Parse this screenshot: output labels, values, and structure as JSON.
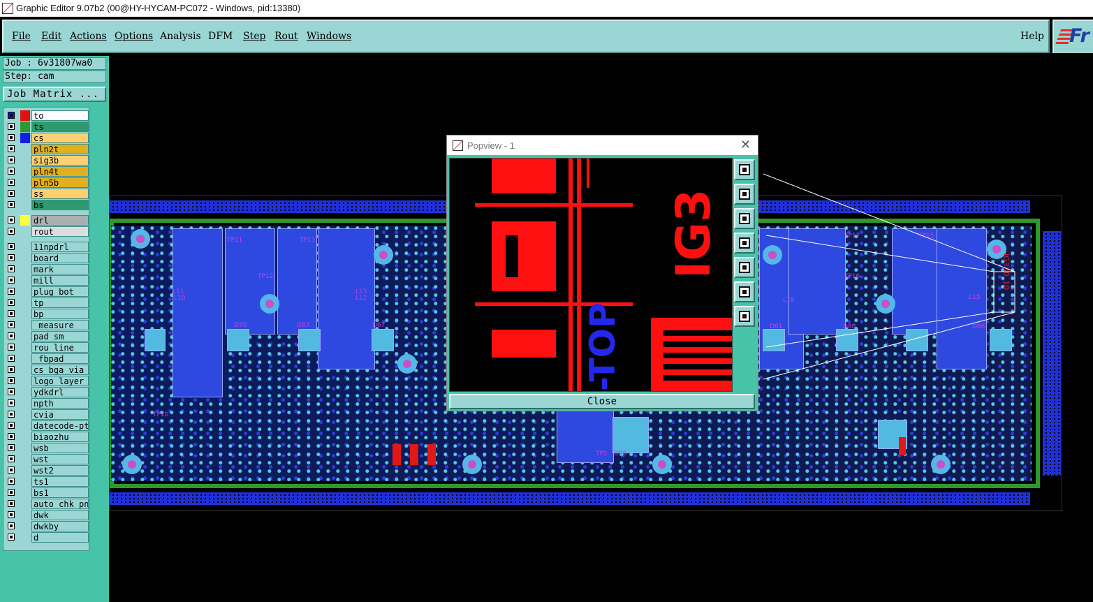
{
  "window": {
    "title": "Graphic Editor 9.07b2 (00@HY-HYCAM-PC072 - Windows, pid:13380)"
  },
  "menu": {
    "items": [
      {
        "label": "File"
      },
      {
        "label": "Edit"
      },
      {
        "label": "Actions"
      },
      {
        "label": "Options"
      },
      {
        "label": "Analysis"
      },
      {
        "label": "DFM"
      },
      {
        "label": "Step"
      },
      {
        "label": "Rout"
      },
      {
        "label": "Windows"
      }
    ],
    "help": "Help",
    "logo_text": "Fr"
  },
  "job": {
    "job_line": "Job : 6v31807wa0",
    "step_line": "Step: cam",
    "matrix_button": "Job Matrix ..."
  },
  "layers": [
    {
      "name": "to",
      "color": "#e01010",
      "bg": "#ffffff",
      "on": true
    },
    {
      "name": "ts",
      "color": "#2e9a2e",
      "bg": "#2e9a6e",
      "on": false
    },
    {
      "name": "cs",
      "color": "#1020e0",
      "bg": "#ffd070",
      "on": false
    },
    {
      "name": "pln2t",
      "color": "",
      "bg": "#e0b020",
      "on": false
    },
    {
      "name": "sig3b",
      "color": "",
      "bg": "#ffd070",
      "on": false
    },
    {
      "name": "pln4t",
      "color": "",
      "bg": "#e0b020",
      "on": false
    },
    {
      "name": "pln5b",
      "color": "",
      "bg": "#e0b020",
      "on": false
    },
    {
      "name": "ss",
      "color": "",
      "bg": "#ffd070",
      "on": false
    },
    {
      "name": "bs",
      "color": "",
      "bg": "#2e9a6e",
      "on": false
    },
    {
      "name": "drl",
      "color": "#ffff40",
      "bg": "#aab0b0",
      "on": false
    },
    {
      "name": "rout",
      "color": "",
      "bg": "#dddddd",
      "on": false
    },
    {
      "name": "11npdrl",
      "color": "",
      "bg": "#9ad6d4",
      "on": false
    },
    {
      "name": "board",
      "color": "",
      "bg": "#9ad6d4",
      "on": false
    },
    {
      "name": "mark",
      "color": "",
      "bg": "#9ad6d4",
      "on": false
    },
    {
      "name": "mill",
      "color": "",
      "bg": "#9ad6d4",
      "on": false
    },
    {
      "name": "plug_bot",
      "color": "",
      "bg": "#9ad6d4",
      "on": false
    },
    {
      "name": "tp",
      "color": "",
      "bg": "#9ad6d4",
      "on": false
    },
    {
      "name": "bp",
      "color": "",
      "bg": "#9ad6d4",
      "on": false
    },
    {
      "name": "_measure",
      "color": "",
      "bg": "#9ad6d4",
      "on": false
    },
    {
      "name": "pad_sm",
      "color": "",
      "bg": "#9ad6d4",
      "on": false
    },
    {
      "name": "rou_line",
      "color": "",
      "bg": "#9ad6d4",
      "on": false
    },
    {
      "name": "_fbpad",
      "color": "",
      "bg": "#9ad6d4",
      "on": false
    },
    {
      "name": "cs_bga_via",
      "color": "",
      "bg": "#9ad6d4",
      "on": false
    },
    {
      "name": "logo_layer_t",
      "color": "",
      "bg": "#9ad6d4",
      "on": false
    },
    {
      "name": "ydkdrl",
      "color": "",
      "bg": "#9ad6d4",
      "on": false
    },
    {
      "name": "npth",
      "color": "",
      "bg": "#9ad6d4",
      "on": false
    },
    {
      "name": "cvia",
      "color": "",
      "bg": "#9ad6d4",
      "on": false
    },
    {
      "name": "datecode-ptc",
      "color": "",
      "bg": "#9ad6d4",
      "on": false
    },
    {
      "name": "biaozhu",
      "color": "",
      "bg": "#9ad6d4",
      "on": false
    },
    {
      "name": "wsb",
      "color": "",
      "bg": "#9ad6d4",
      "on": false
    },
    {
      "name": "wst",
      "color": "",
      "bg": "#9ad6d4",
      "on": false
    },
    {
      "name": "wst2",
      "color": "",
      "bg": "#9ad6d4",
      "on": false
    },
    {
      "name": "ts1",
      "color": "",
      "bg": "#9ad6d4",
      "on": false
    },
    {
      "name": "bs1",
      "color": "",
      "bg": "#9ad6d4",
      "on": false
    },
    {
      "name": "auto_chk_pnl",
      "color": "",
      "bg": "#9ad6d4",
      "on": false
    },
    {
      "name": "dwk",
      "color": "",
      "bg": "#9ad6d4",
      "on": false
    },
    {
      "name": "dwkby",
      "color": "",
      "bg": "#9ad6d4",
      "on": false
    },
    {
      "name": "d",
      "color": "",
      "bg": "#9ad6d4",
      "on": false
    }
  ],
  "popview": {
    "title": "Popview - 1",
    "close_label": "Close",
    "tools": [
      "zoom-icon",
      "pan-up-icon",
      "pan-down-icon",
      "pan-left-icon",
      "pan-right-icon",
      "zoom-fit-icon",
      "center-icon"
    ],
    "view_text": {
      "top": "-TOP",
      "ig": "IG3"
    }
  },
  "board_labels": [
    "TP11",
    "TP13",
    "TP12",
    "TP17",
    "TP15",
    "TP16",
    "L11",
    "L10",
    "L13",
    "L12",
    "L18",
    "L15",
    "D70",
    "D87",
    "D67",
    "D81",
    "D88",
    "D66",
    "TP10",
    "TP2",
    "D90",
    "IG380_10"
  ]
}
